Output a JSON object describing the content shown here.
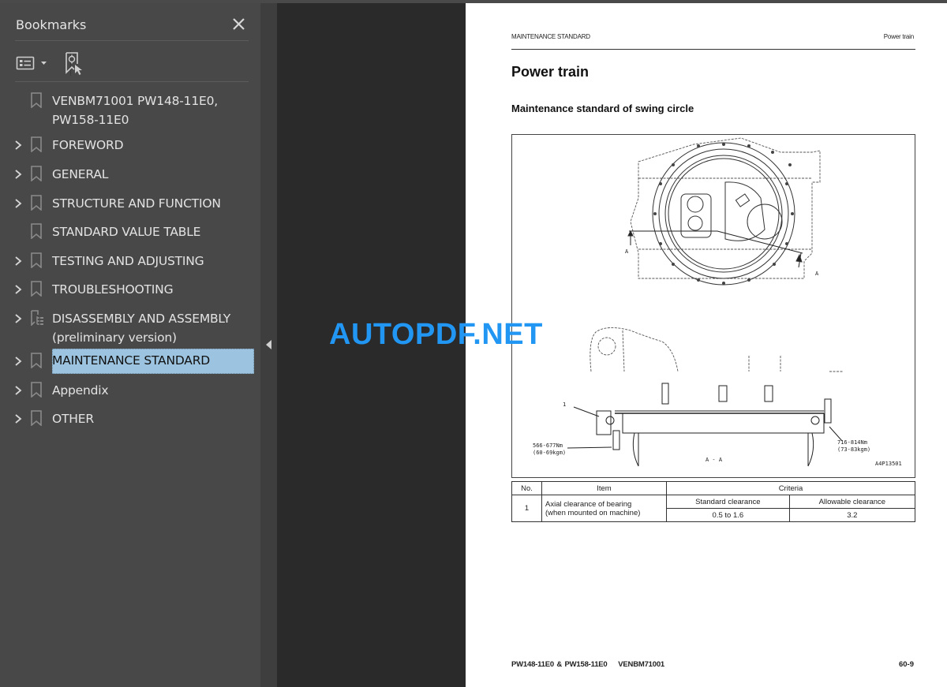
{
  "sidebar": {
    "title": "Bookmarks",
    "items": [
      {
        "label_line1": "VENBM71001 PW148-11E0,",
        "label_line2": "PW158-11E0",
        "expandable": false,
        "icon": "bookmark-icon"
      },
      {
        "label": "FOREWORD",
        "expandable": true,
        "icon": "bookmark-icon"
      },
      {
        "label": "GENERAL",
        "expandable": true,
        "icon": "bookmark-icon"
      },
      {
        "label": "STRUCTURE AND FUNCTION",
        "expandable": true,
        "icon": "bookmark-icon"
      },
      {
        "label": "STANDARD VALUE TABLE",
        "expandable": false,
        "icon": "bookmark-icon"
      },
      {
        "label": "TESTING AND ADJUSTING",
        "expandable": true,
        "icon": "bookmark-icon"
      },
      {
        "label": "TROUBLESHOOTING",
        "expandable": true,
        "icon": "bookmark-icon"
      },
      {
        "label_line1": "DISASSEMBLY AND ASSEMBLY",
        "label_line2": "(preliminary version)",
        "expandable": true,
        "icon": "document-tree-icon"
      },
      {
        "label": "MAINTENANCE STANDARD",
        "expandable": true,
        "icon": "bookmark-icon",
        "selected": true
      },
      {
        "label": "Appendix",
        "expandable": true,
        "icon": "bookmark-icon"
      },
      {
        "label": "OTHER",
        "expandable": true,
        "icon": "bookmark-icon"
      }
    ],
    "selected_color": "#9cc3df"
  },
  "page": {
    "header_left": "MAINTENANCE STANDARD",
    "header_right": "Power train",
    "title": "Power train",
    "subtitle": "Maintenance standard of swing circle",
    "figure": {
      "callout_number": "1",
      "torque_left_line1": "566-677Nm",
      "torque_left_line2": "(60-69kgm)",
      "torque_right_line1": "716-814Nm",
      "torque_right_line2": "(73-83kgm)",
      "section_label": "A - A",
      "section_marker": "A",
      "figure_id": "A4P13501"
    },
    "table": {
      "headers": {
        "no": "No.",
        "item": "Item",
        "criteria": "Criteria"
      },
      "sub_headers": {
        "standard": "Standard clearance",
        "allowable": "Allowable clearance"
      },
      "rows": [
        {
          "no": "1",
          "item_line1": "Axial clearance of bearing",
          "item_line2": "(when mounted on machine)",
          "standard": "0.5 to 1.6",
          "allowable": "3.2"
        }
      ]
    },
    "footer_left": "PW148-11E0 & PW158-11E0    VENBM71001",
    "footer_right": "60-9"
  },
  "watermark": {
    "text": "AUTOPDF.NET",
    "color": "#2196f3"
  }
}
